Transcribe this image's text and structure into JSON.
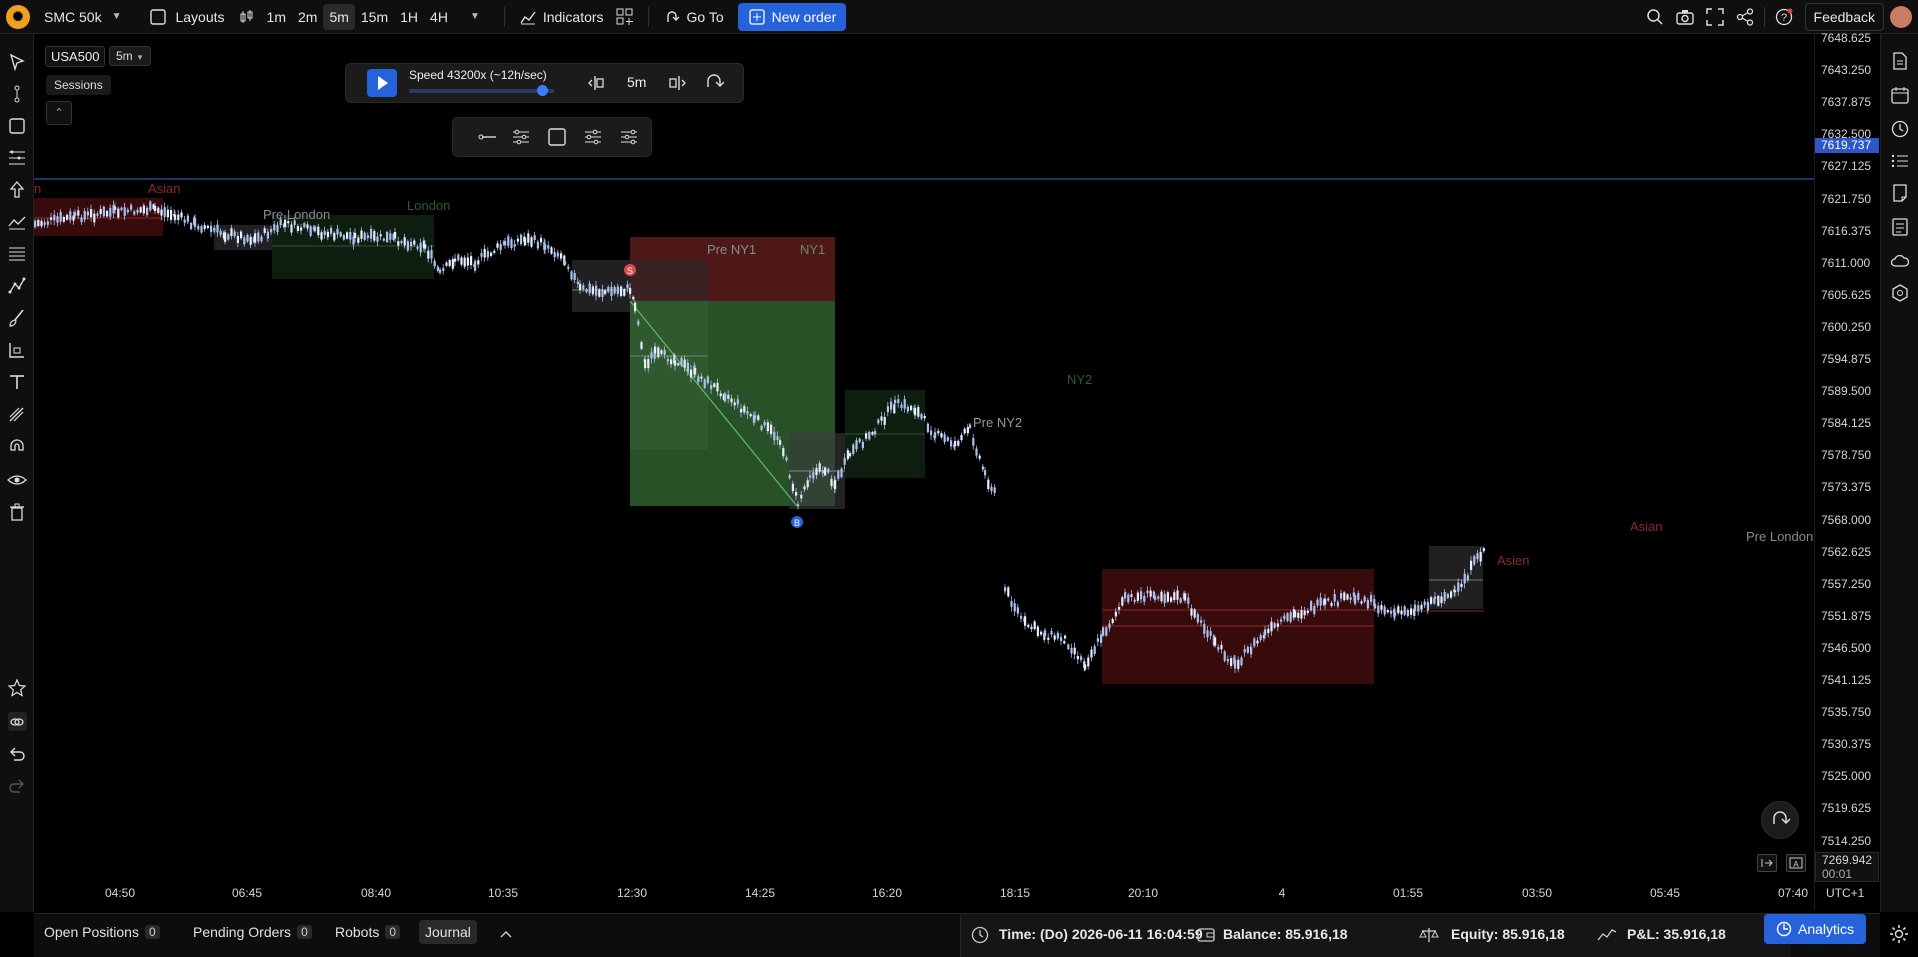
{
  "topbar": {
    "logo_glyph": "✺",
    "account": "SMC 50k",
    "layouts": "Layouts",
    "timeframes": [
      "1m",
      "2m",
      "5m",
      "15m",
      "1H",
      "4H"
    ],
    "active_timeframe": "5m",
    "indicators": "Indicators",
    "goto": "Go To",
    "new_order": "New order",
    "feedback": "Feedback"
  },
  "chart": {
    "symbol": "USA500",
    "timeframe": "5m",
    "sessions_tooltip": "Sessions",
    "collapse_glyph": "⌃",
    "current_price": "7619.737",
    "price_labels": [
      "7648.625",
      "7643.250",
      "7637.875",
      "7632.500",
      "7627.125",
      "7621.750",
      "7616.375",
      "7611.000",
      "7605.625",
      "7600.250",
      "7594.875",
      "7589.500",
      "7584.125",
      "7578.750",
      "7573.375",
      "7568.000",
      "7562.625",
      "7557.250",
      "7551.875",
      "7546.500",
      "7541.125",
      "7535.750",
      "7530.375",
      "7525.000",
      "7519.625",
      "7514.250"
    ],
    "time_labels": [
      "04:50",
      "06:45",
      "08:40",
      "10:35",
      "12:30",
      "14:25",
      "16:20",
      "18:15",
      "20:10",
      "4",
      "01:55",
      "03:50",
      "05:45",
      "07:40"
    ],
    "countdown_price": "7269.942",
    "countdown": "00:01",
    "timezone": "UTC+1",
    "sessions": {
      "asian_1": "Asian",
      "asian_1_cut": "n",
      "pre_london_1": "Pre London",
      "london": "London",
      "pre_ny1": "Pre NY1",
      "ny1": "NY1",
      "pre_ny2": "Pre NY2",
      "ny2": "NY2",
      "asian_2": "Asian",
      "asien": "Asien",
      "pre_london_2": "Pre London"
    },
    "trade_marks": {
      "sell": "S",
      "buy": "B"
    }
  },
  "replay": {
    "speed": "Speed 43200x (~12h/sec)",
    "speed_fraction": 0.92,
    "timeframe": "5m"
  },
  "bottom": {
    "open_positions": "Open Positions",
    "open_positions_count": "0",
    "pending_orders": "Pending Orders",
    "pending_orders_count": "0",
    "robots": "Robots",
    "robots_count": "0",
    "journal": "Journal",
    "time": "Time: (Do) 2026-06-11 16:04:59",
    "balance": "Balance: 85.916,18",
    "equity": "Equity: 85.916,18",
    "pnl": "P&L: 35.916,18",
    "analytics": "Analytics"
  },
  "colors": {
    "accent": "#2662d9",
    "candle": "#a9c2ee",
    "session_asian": "#3a0b0d",
    "session_london": "#0e1f10",
    "pre_session": "#242424",
    "profit_zone": "#3f7d3e",
    "loss_zone": "#6a2020",
    "price_line": "#3b5fd0"
  }
}
